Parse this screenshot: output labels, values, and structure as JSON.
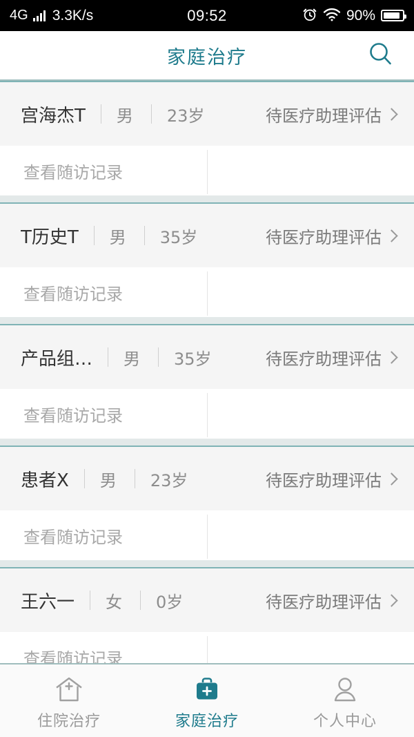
{
  "status_bar": {
    "network_type": "4G",
    "signal_icon": "signal-bars-icon",
    "net_speed": "3.3K/s",
    "time": "09:52",
    "alarm_icon": "alarm-clock-icon",
    "wifi_icon": "wifi-icon",
    "battery_percent": "90%",
    "battery_icon": "battery-icon"
  },
  "header": {
    "title": "家庭治疗",
    "search_icon": "search-icon",
    "accent_color": "#1e7b8c"
  },
  "list": {
    "followup_label": "查看随访记录",
    "chevron_icon": "chevron-right-icon",
    "patients": [
      {
        "name": "宫海杰T",
        "gender": "男",
        "age": "23岁",
        "status": "待医疗助理评估",
        "followup": "查看随访记录"
      },
      {
        "name": "T历史T",
        "gender": "男",
        "age": "35岁",
        "status": "待医疗助理评估",
        "followup": "查看随访记录"
      },
      {
        "name": "产品组…",
        "gender": "男",
        "age": "35岁",
        "status": "待医疗助理评估",
        "followup": "查看随访记录"
      },
      {
        "name": "患者X",
        "gender": "男",
        "age": "23岁",
        "status": "待医疗助理评估",
        "followup": "查看随访记录"
      },
      {
        "name": "王六一",
        "gender": "女",
        "age": "0岁",
        "status": "待医疗助理评估",
        "followup": "查看随访记录"
      }
    ]
  },
  "tab_bar": {
    "active_color": "#1e7b8c",
    "inactive_color": "#9a9a9a",
    "items": [
      {
        "label": "住院治疗",
        "icon": "hospital-home-icon",
        "active": false
      },
      {
        "label": "家庭治疗",
        "icon": "medical-bag-icon",
        "active": true
      },
      {
        "label": "个人中心",
        "icon": "person-icon",
        "active": false
      }
    ]
  }
}
